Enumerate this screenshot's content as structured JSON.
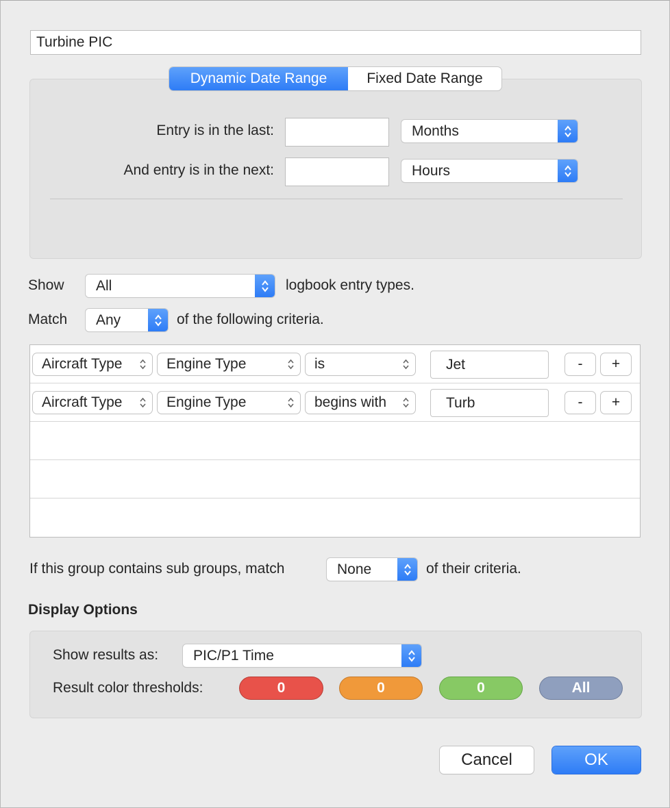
{
  "group_name": "Turbine PIC",
  "date_range": {
    "tabs": [
      {
        "label": "Dynamic Date Range",
        "active": true
      },
      {
        "label": "Fixed Date Range",
        "active": false
      }
    ],
    "last_label": "Entry is in the last:",
    "last_value": "",
    "last_unit": "Months",
    "next_label": "And entry is in the next:",
    "next_value": "",
    "next_unit": "Hours"
  },
  "show": {
    "label": "Show",
    "value": "All",
    "suffix": "logbook entry types."
  },
  "match": {
    "label": "Match",
    "value": "Any",
    "suffix": "of the following criteria."
  },
  "criteria": [
    {
      "field": "Aircraft Type",
      "property": "Engine Type",
      "operator": "is",
      "value": "Jet",
      "minus": "-",
      "plus": "+"
    },
    {
      "field": "Aircraft Type",
      "property": "Engine Type",
      "operator": "begins with",
      "value": "Turb",
      "minus": "-",
      "plus": "+"
    }
  ],
  "subgroups": {
    "prefix": "If this group contains sub groups, match",
    "value": "None",
    "suffix": "of their criteria."
  },
  "display_options": {
    "heading": "Display Options",
    "show_results_label": "Show results as:",
    "show_results_value": "PIC/P1 Time",
    "thresholds_label": "Result color thresholds:",
    "thresholds": [
      {
        "value": "0",
        "color": "#e8524a"
      },
      {
        "value": "0",
        "color": "#f0993a"
      },
      {
        "value": "0",
        "color": "#87c964"
      },
      {
        "value": "All",
        "color": "#8f9fbe"
      }
    ]
  },
  "buttons": {
    "cancel": "Cancel",
    "ok": "OK"
  },
  "colors": {
    "accent": "#2e7cf6",
    "window_bg": "#ececec"
  }
}
